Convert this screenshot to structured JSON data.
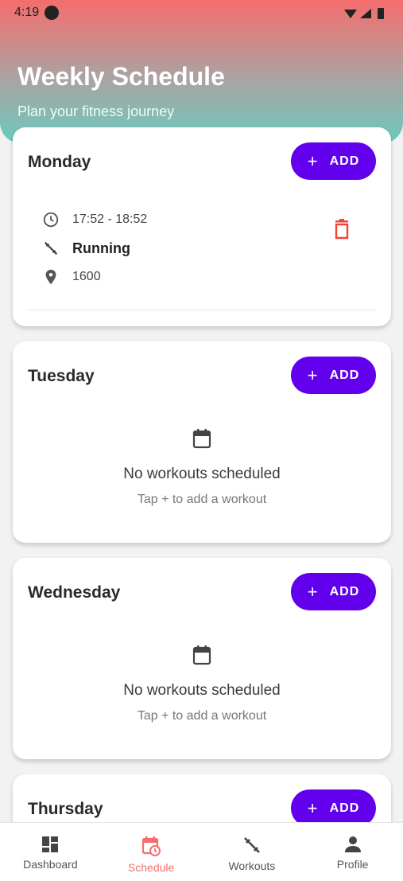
{
  "status_bar": {
    "time": "4:19"
  },
  "header": {
    "title": "Weekly Schedule",
    "subtitle": "Plan your fitness journey"
  },
  "days": [
    {
      "name": "Monday",
      "add_label": "ADD",
      "entries": [
        {
          "time": "17:52 - 18:52",
          "workout": "Running",
          "location": "1600"
        }
      ]
    },
    {
      "name": "Tuesday",
      "add_label": "ADD",
      "empty_title": "No workouts scheduled",
      "empty_subtitle": "Tap + to add a workout"
    },
    {
      "name": "Wednesday",
      "add_label": "ADD",
      "empty_title": "No workouts scheduled",
      "empty_subtitle": "Tap + to add a workout"
    },
    {
      "name": "Thursday",
      "add_label": "ADD"
    }
  ],
  "nav": {
    "items": [
      {
        "label": "Dashboard",
        "icon": "dashboard-icon"
      },
      {
        "label": "Schedule",
        "icon": "calendar-clock-icon",
        "active": true
      },
      {
        "label": "Workouts",
        "icon": "dumbbell-icon"
      },
      {
        "label": "Profile",
        "icon": "person-icon"
      }
    ]
  },
  "colors": {
    "accent": "#6200ee",
    "active_tab": "#f56d6d",
    "delete": "#f44336"
  }
}
